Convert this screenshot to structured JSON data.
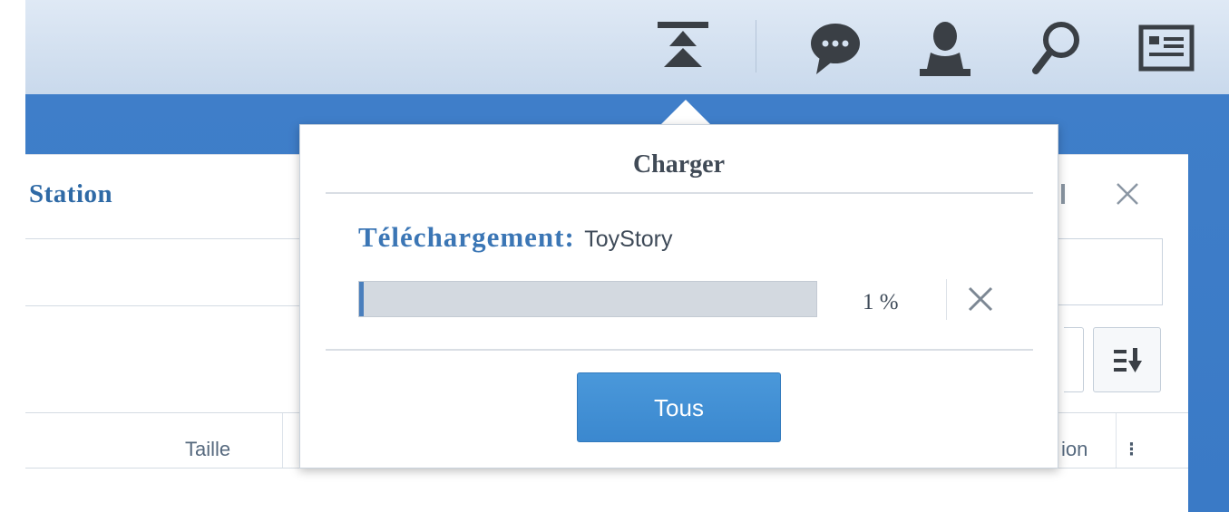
{
  "window": {
    "title": "Station",
    "columns": [
      "Taille",
      "ion"
    ],
    "more": "⁝"
  },
  "upload_popover": {
    "title": "Charger",
    "download_label": "Téléchargement:",
    "file_name": "ToyStory",
    "progress_fraction": 0.01,
    "percent_text": "1 %",
    "all_button": "Tous"
  },
  "icons": {
    "topbar": [
      "upload-queue-icon",
      "chat-icon",
      "user-icon",
      "search-icon",
      "widgets-icon"
    ],
    "window": [
      "close-icon",
      "sort-icon"
    ],
    "popover": [
      "cancel-icon"
    ]
  },
  "colors": {
    "topbar": "#d4e1f0",
    "accent_blue": "#3b7bc8",
    "button_blue": "#4290d4",
    "label_blue": "#3b76b5",
    "icon_dark": "#3a3f45"
  }
}
